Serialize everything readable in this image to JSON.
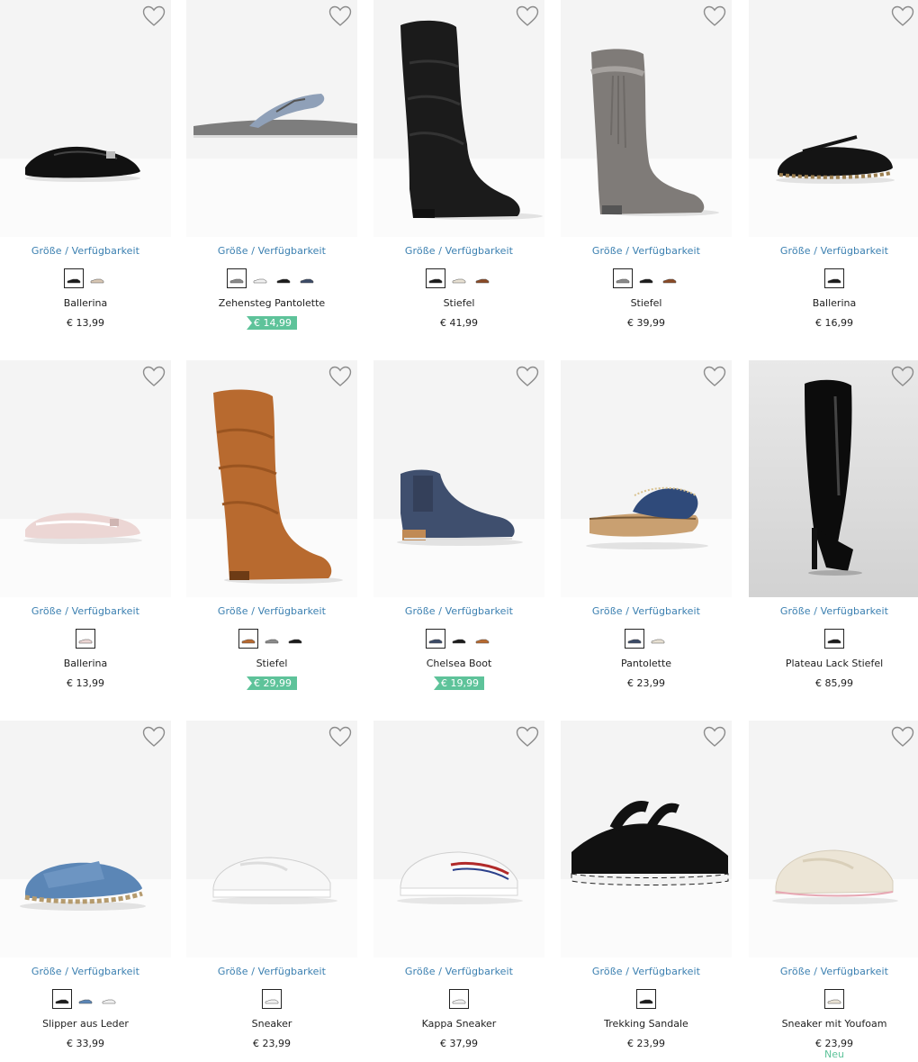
{
  "common": {
    "size_link_label": "Größe / Verfügbarkeit",
    "colors": {
      "link": "#3a7fb0",
      "sale_badge": "#5ec39a",
      "text": "#1e1e1e"
    }
  },
  "products": [
    {
      "name": "Ballerina",
      "price": "€ 13,99",
      "sale": false,
      "swatches": [
        "black",
        "beige"
      ],
      "image": "black-patent-ballerina"
    },
    {
      "name": "Zehensteg Pantolette",
      "price": "€ 14,99",
      "sale": true,
      "swatches": [
        "grey",
        "white",
        "black",
        "navy"
      ],
      "image": "grey-flip-flop"
    },
    {
      "name": "Stiefel",
      "price": "€ 41,99",
      "sale": false,
      "swatches": [
        "black",
        "cream",
        "brown"
      ],
      "image": "black-slouch-boot"
    },
    {
      "name": "Stiefel",
      "price": "€ 39,99",
      "sale": false,
      "swatches": [
        "grey",
        "black",
        "brown"
      ],
      "image": "grey-fringe-boot"
    },
    {
      "name": "Ballerina",
      "price": "€ 16,99",
      "sale": false,
      "swatches": [
        "black"
      ],
      "image": "black-strap-ballerina"
    },
    {
      "name": "Ballerina",
      "price": "€ 13,99",
      "sale": false,
      "swatches": [
        "rose"
      ],
      "image": "rose-ballerina"
    },
    {
      "name": "Stiefel",
      "price": "€ 29,99",
      "sale": true,
      "swatches": [
        "cognac",
        "grey",
        "black"
      ],
      "image": "cognac-slouch-boot"
    },
    {
      "name": "Chelsea Boot",
      "price": "€ 19,99",
      "sale": true,
      "swatches": [
        "navy",
        "black",
        "cognac"
      ],
      "image": "navy-chelsea-boot"
    },
    {
      "name": "Pantolette",
      "price": "€ 23,99",
      "sale": false,
      "swatches": [
        "navy",
        "cream"
      ],
      "image": "navy-wedge-mule"
    },
    {
      "name": "Plateau Lack Stiefel",
      "price": "€ 85,99",
      "sale": false,
      "swatches": [
        "black"
      ],
      "image": "black-patent-thigh-boot"
    },
    {
      "name": "Slipper aus Leder",
      "price": "€ 33,99",
      "sale": false,
      "swatches": [
        "black",
        "blue",
        "white"
      ],
      "image": "blue-leather-slipper"
    },
    {
      "name": "Sneaker",
      "price": "€ 23,99",
      "sale": false,
      "swatches": [
        "white"
      ],
      "image": "white-sneaker"
    },
    {
      "name": "Kappa Sneaker",
      "price": "€ 37,99",
      "sale": false,
      "swatches": [
        "white"
      ],
      "image": "white-kappa-sneaker"
    },
    {
      "name": "Trekking Sandale",
      "price": "€ 23,99",
      "sale": false,
      "swatches": [
        "black"
      ],
      "image": "black-trekking-sandal"
    },
    {
      "name": "Sneaker mit Youfoam",
      "price": "€ 23,99",
      "sale": false,
      "swatches": [
        "cream"
      ],
      "image": "cream-sneaker",
      "badge": "Neu"
    }
  ]
}
